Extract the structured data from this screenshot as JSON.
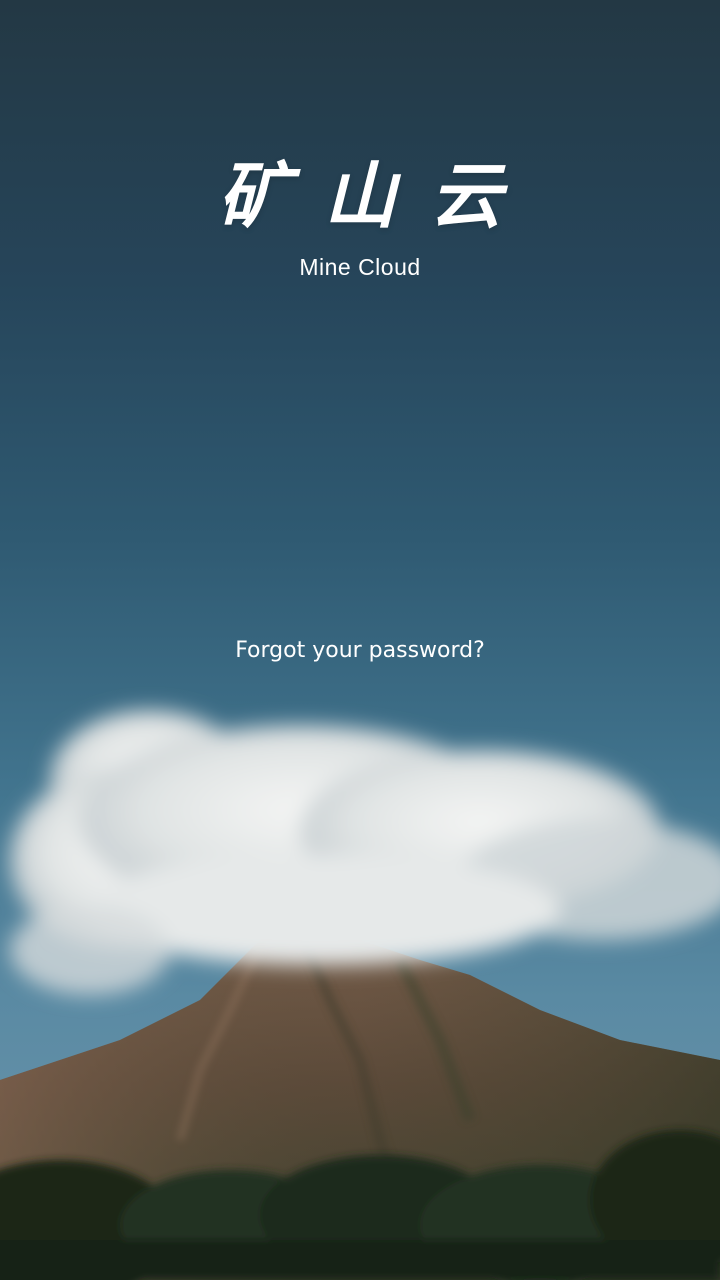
{
  "brand": {
    "title_cn": "矿山云",
    "title_en": "Mine Cloud"
  },
  "links": {
    "forgot_password": "Forgot your password?"
  },
  "colors": {
    "sky_top": "#233844",
    "sky_bottom": "#6f97ad",
    "cloud": "#e9ecec",
    "mountain": "#5b4a3b",
    "forest": "#1f2a1c",
    "text": "#ffffff"
  }
}
